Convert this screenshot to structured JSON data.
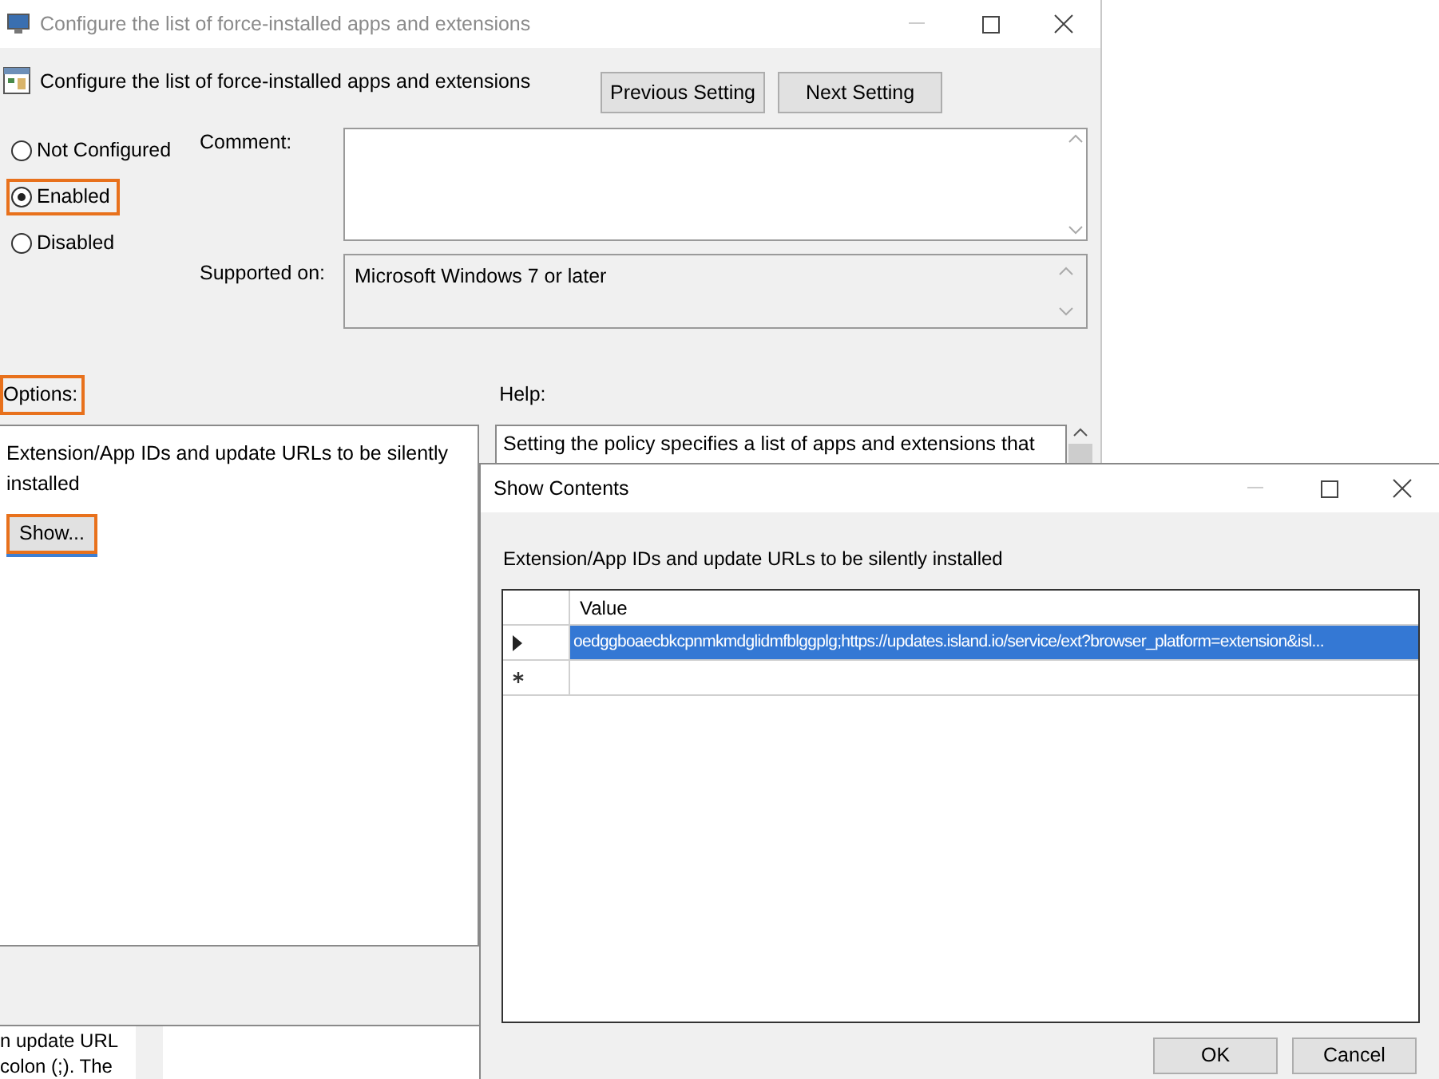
{
  "window": {
    "title": "Configure the list of force-installed apps and extensions"
  },
  "header": {
    "title": "Configure the list of force-installed apps and extensions",
    "buttons": [
      "Previous Setting",
      "Next Setting"
    ]
  },
  "state_options": [
    {
      "label": "Not Configured",
      "selected": false,
      "highlighted": false
    },
    {
      "label": "Enabled",
      "selected": true,
      "highlighted": true
    },
    {
      "label": "Disabled",
      "selected": false,
      "highlighted": false
    }
  ],
  "comment": {
    "label": "Comment:"
  },
  "supported_on": {
    "label": "Supported on:",
    "value": "Microsoft Windows 7 or later"
  },
  "options": {
    "label": "Options:",
    "highlighted": true,
    "description": "Extension/App IDs and update URLs to be silently installed",
    "button": {
      "label": "Show...",
      "highlighted": true
    }
  },
  "help": {
    "label": "Help:",
    "lines": [
      "Setting the policy specifies a list of apps and extensions that"
    ],
    "fragments": [
      "n update URL",
      "colon (;). The"
    ]
  },
  "dialog": {
    "title": "Show Contents",
    "description": "Extension/App IDs and update URLs to be silently installed",
    "table": {
      "columns": [
        "Value"
      ],
      "rows": [
        {
          "kind": "current",
          "value": "oedggboaecbkcpnmkmdglidmfblggplg;https://updates.island.io/service/ext?browser_platform=extension&isl...",
          "selected": true
        },
        {
          "kind": "new",
          "selected": false
        }
      ]
    },
    "buttons": [
      "OK",
      "Cancel"
    ]
  }
}
